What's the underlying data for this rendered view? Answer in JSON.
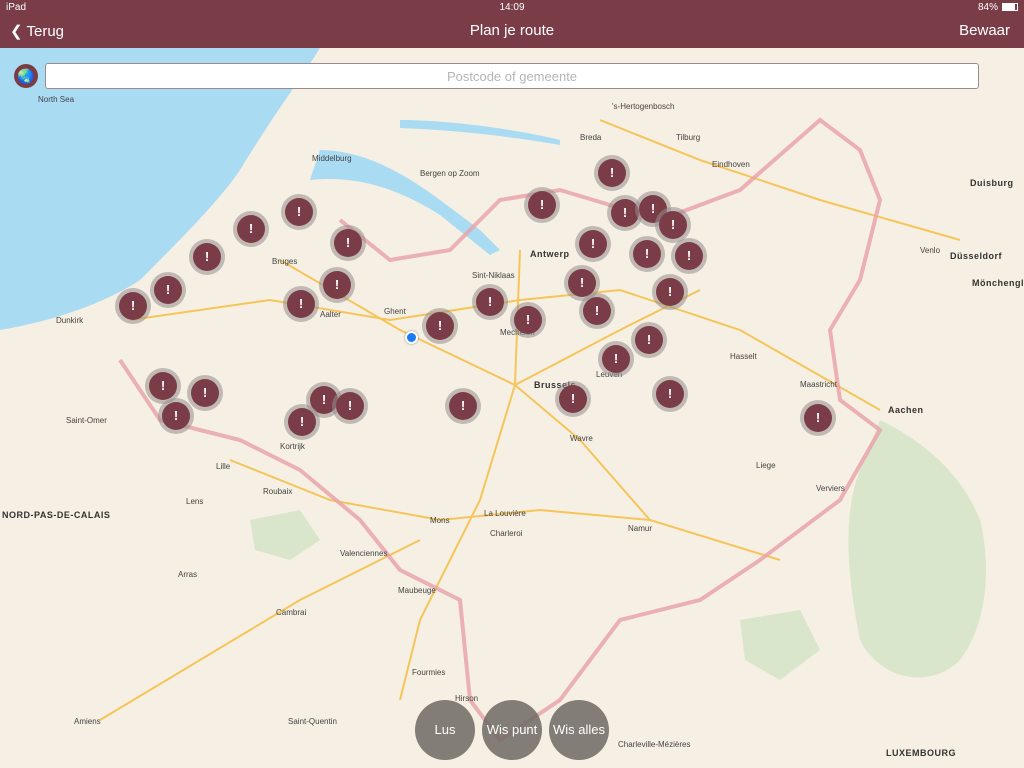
{
  "status_bar": {
    "device": "iPad",
    "time": "14:09",
    "battery": "84%"
  },
  "nav": {
    "back_label": "Terug",
    "title": "Plan je route",
    "save_label": "Bewaar"
  },
  "search": {
    "placeholder": "Postcode of gemeente",
    "value": ""
  },
  "map": {
    "marker_label": "!",
    "cities": [
      "North Sea",
      "Middelburg",
      "Bergen op Zoom",
      "Breda",
      "Tilburg",
      "'s-Hertogenbosch",
      "Eindhoven",
      "Bruges",
      "Ghent",
      "Antwerp",
      "Sint-Niklaas",
      "Mechelen",
      "Brussels",
      "Leuven",
      "Hasselt",
      "Aalter",
      "Kortrijk",
      "Roubaix",
      "Lille",
      "Dunkirk",
      "Saint-Omer",
      "Liege",
      "Aachen",
      "Maastricht",
      "Namur",
      "Charleroi",
      "Mons",
      "Wavre",
      "Venlo",
      "Düsseldorf",
      "Duisburg",
      "Mönchengladbach",
      "Arras",
      "Cambrai",
      "Amiens",
      "Saint-Quentin",
      "Hirson",
      "Verviers",
      "Valenciennes",
      "Lens",
      "NORD-PAS-DE-CALAIS",
      "LUXEMBOURG",
      "Charleville-Mézières",
      "La Louvière",
      "Maubeuge",
      "Fourmies"
    ],
    "colors": {
      "sea": "#a9dbf2",
      "land": "#f6efe3",
      "marker": "#7a3d48",
      "border": "#e8a0a8",
      "road": "#f5c55a"
    }
  },
  "buttons": {
    "loop": "Lus",
    "clear_point": "Wis punt",
    "clear_all": "Wis alles"
  }
}
